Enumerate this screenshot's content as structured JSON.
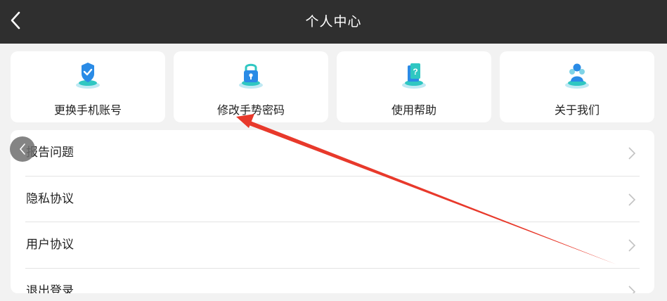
{
  "header": {
    "title": "个人中心",
    "back_icon": "chevron-left-icon"
  },
  "quick_actions": [
    {
      "label": "更换手机账号",
      "icon": "phone-account-icon"
    },
    {
      "label": "修改手势密码",
      "icon": "lock-icon"
    },
    {
      "label": "使用帮助",
      "icon": "help-book-icon"
    },
    {
      "label": "关于我们",
      "icon": "team-icon"
    }
  ],
  "menu": [
    {
      "label": "报告问题"
    },
    {
      "label": "隐私协议"
    },
    {
      "label": "用户协议"
    },
    {
      "label": "退出登录"
    }
  ],
  "floating_back_icon": "chevron-left-icon",
  "annotation": {
    "type": "arrow",
    "color": "#e8392b"
  },
  "colors": {
    "topbar": "#2f2f2f",
    "background": "#f2f2f2",
    "icon_teal": "#2fc7c2",
    "icon_blue": "#2a8be6"
  }
}
